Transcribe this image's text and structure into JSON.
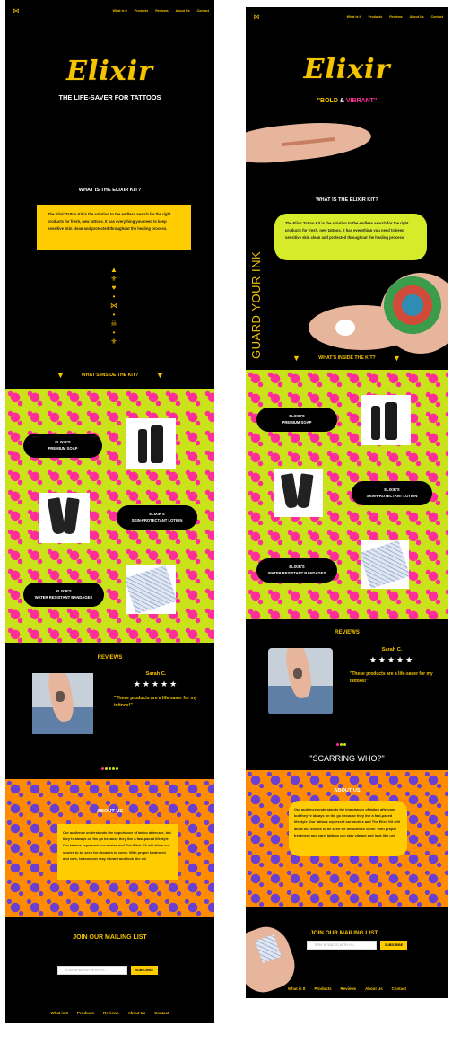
{
  "brand": "Elixir",
  "nav": [
    "What is It",
    "Products",
    "Reviews",
    "About Us",
    "Contact"
  ],
  "artboard1": {
    "tagline": "THE LIFE-SAVER FOR TATTOOS",
    "what_title": "WHAT IS THE ELIXIR KIT?",
    "what_text": "The Elixir Tattoo Kit is the solution to the endless search for the right products for fresh, new tattoos. It has everything you need to keep sensitive skin clean and protected throughout the healing process.",
    "inside_title": "WHAT'S INSIDE THE KIT?",
    "products": [
      {
        "label_1": "ELIXIR'S",
        "label_2": "PREMIUM SOAP"
      },
      {
        "label_1": "ELIXIR'S",
        "label_2": "SKIN-PROTECTANT LOTION"
      },
      {
        "label_1": "ELIXIR'S",
        "label_2": "WATER RESISTANT BANDAGES"
      }
    ],
    "reviews_title": "REVIEWS",
    "reviewer": "Sarah C.",
    "stars": "★★★★★",
    "review_text": "\"These products are a life-saver for my tattoos!\"",
    "about_title": "ABOUT US",
    "about_text": "Our audience understands the importance of tattoo aftercare, but they're always on the go because they live a fast-paced lifestyle. Our tattoos represent our stories and The Elixir Kit will allow our stories to be seen for decades to come. With proper treatment and care, tattoos can stay vibrant and look like us!",
    "mailing_title": "JOIN OUR MAILING LIST",
    "input_placeholder": "STAY UPDATED WITH US...",
    "subscribe": "SUBSCRIBE"
  },
  "artboard2": {
    "tagline_bold": "\"BOLD",
    "tagline_amp": "&",
    "tagline_vibrant": "VIBRANT\"",
    "what_title": "WHAT IS THE ELIXIR KIT?",
    "what_text": "The Elixir Tattoo Kit is the solution to the endless search for the right products for fresh, new tattoos. It has everything you need to keep sensitive skin clean and protected throughout the healing process.",
    "vertical_text": "GUARD YOUR INK",
    "inside_title": "WHAT'S INSIDE THE KIT?",
    "products": [
      {
        "label_1": "ELIXIR'S",
        "label_2": "PREMIUM SOAP"
      },
      {
        "label_1": "ELIXIR'S",
        "label_2": "SKIN-PROTECTANT LOTION"
      },
      {
        "label_1": "ELIXIR'S",
        "label_2": "WATER RESISTANT BANDAGES"
      }
    ],
    "reviews_title": "REVIEWS",
    "reviewer": "Sarah C.",
    "stars": "★★★★★",
    "review_text": "\"These products are a life-saver for my tattoos!\"",
    "scarring_title": "\"SCARRING WHO?\"",
    "about_title": "ABOUT US",
    "about_text": "Our audience understands the importance of tattoo aftercare, but they're always on the go because they live a fast-paced lifestyle. Our tattoos represent our stories and The Elixir Kit will allow our stories to be seen for decades to come. With proper treatment and care, tattoos can stay vibrant and look like us!",
    "mailing_title": "JOIN OUR MAILING LIST",
    "input_placeholder": "STAY UPDATED WITH US...",
    "subscribe": "SUBSCRIBE"
  },
  "colors": {
    "accent": "#f5c400",
    "pink": "#ff2e99",
    "lime": "#c9e21a",
    "orange": "#ff8c00",
    "purple": "#6a3fd2"
  },
  "icons": [
    "butterfly-icon",
    "arrow-down-icon",
    "skull-icon",
    "star-icon"
  ]
}
